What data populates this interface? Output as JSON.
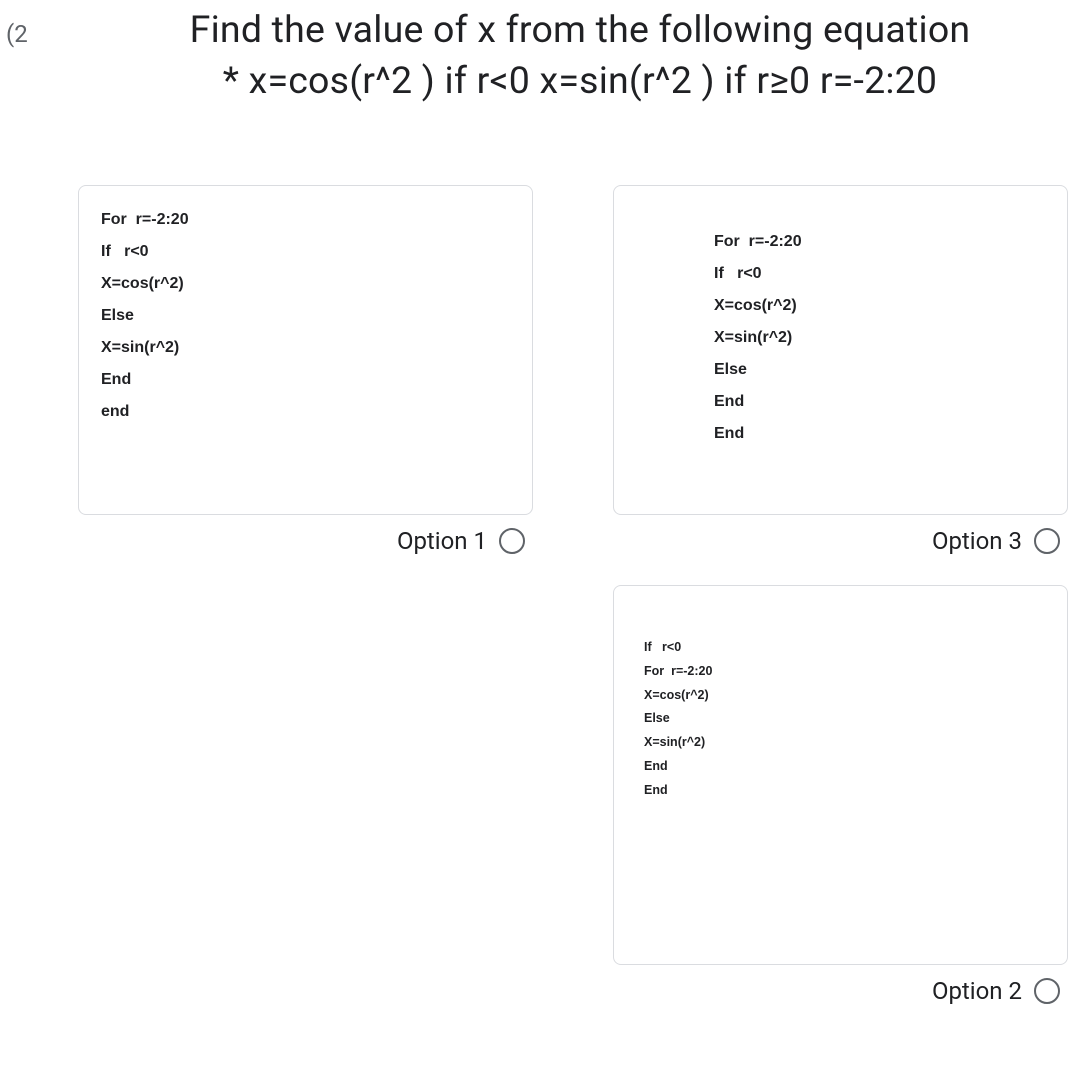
{
  "question_number": "(2",
  "question": {
    "line1": "Find the value of x from the following equation",
    "line2": "* x=cos(r^2 ) if r<0 x=sin(r^2 ) if r≥0 r=-2:20"
  },
  "options": {
    "opt1": {
      "label": "Option 1",
      "code": [
        "For  r=-2:20",
        "If   r<0",
        "X=cos(r^2)",
        "Else",
        "X=sin(r^2)",
        "End",
        "end"
      ]
    },
    "opt3": {
      "label": "Option 3",
      "code": [
        "For  r=-2:20",
        "If   r<0",
        "X=cos(r^2)",
        "X=sin(r^2)",
        "Else",
        "End",
        "End"
      ]
    },
    "opt2": {
      "label": "Option 2",
      "code": [
        "If   r<0",
        "For  r=-2:20",
        "X=cos(r^2)",
        "Else",
        "X=sin(r^2)",
        "End",
        "End"
      ]
    }
  }
}
